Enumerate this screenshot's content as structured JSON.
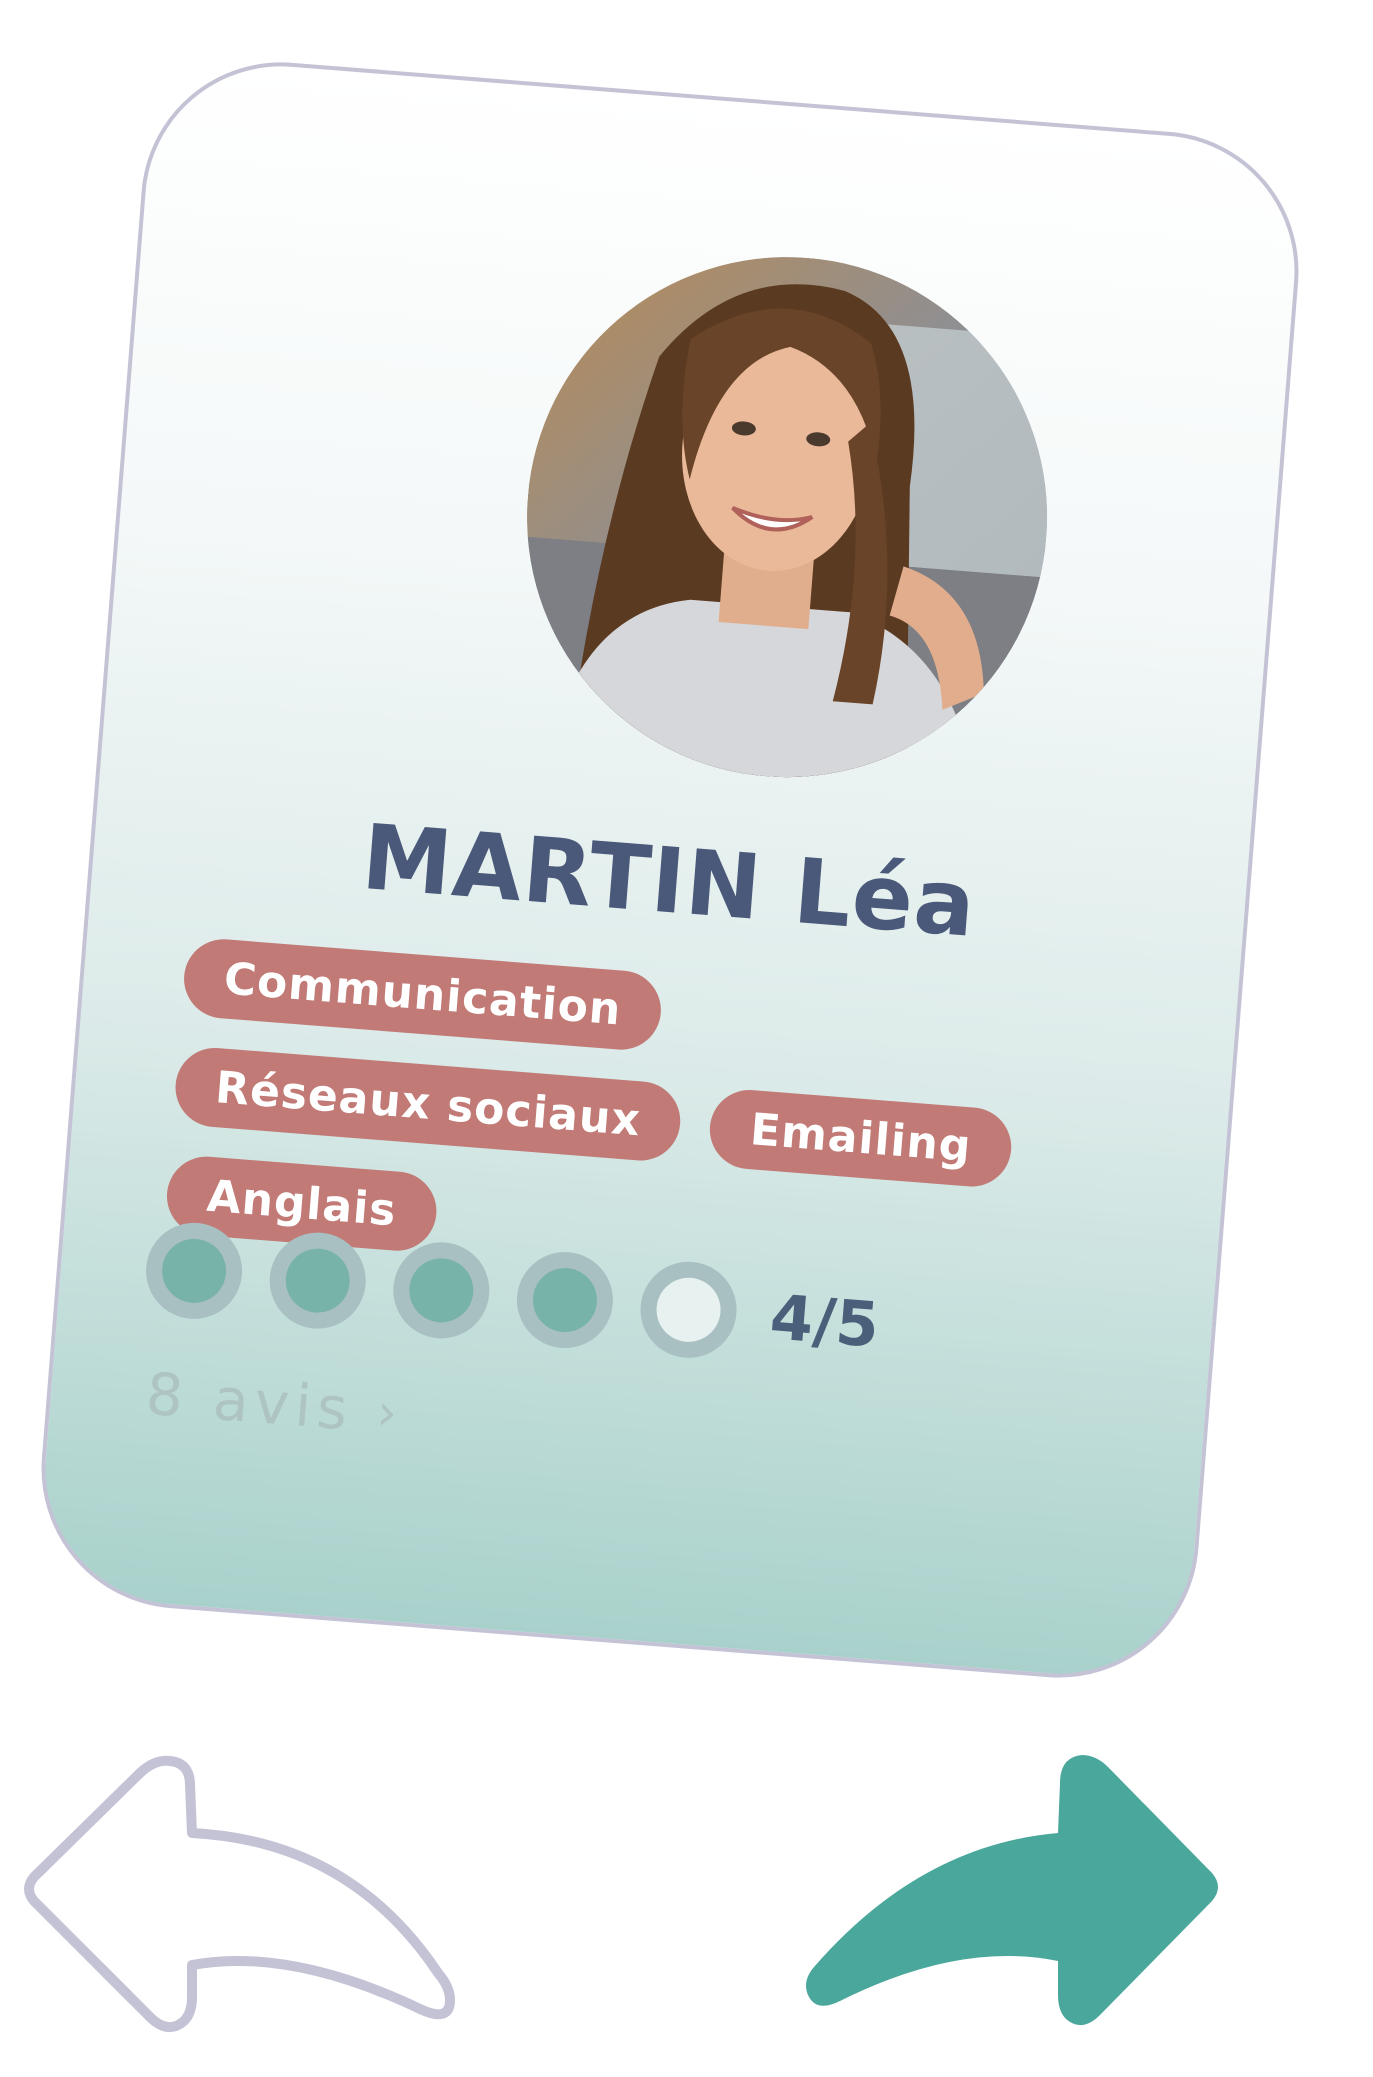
{
  "profile": {
    "name": "MARTIN Léa",
    "photo_alt": "profile-photo"
  },
  "skills": [
    "Communication",
    "Réseaux sociaux",
    "Emailing",
    "Anglais"
  ],
  "rating": {
    "value": 4,
    "max": 5,
    "label": "4/5"
  },
  "reviews": {
    "label": "8 avis",
    "chevron": "›"
  },
  "actions": {
    "back_icon": "arrow-back-icon",
    "forward_icon": "arrow-forward-icon"
  },
  "colors": {
    "tag": "#c17a76",
    "name": "#4a5879",
    "rating_fill": "#78b3a8",
    "rating_ring": "#a9c0c3",
    "forward": "#4aa79c",
    "back_outline": "#c4c3d6"
  }
}
